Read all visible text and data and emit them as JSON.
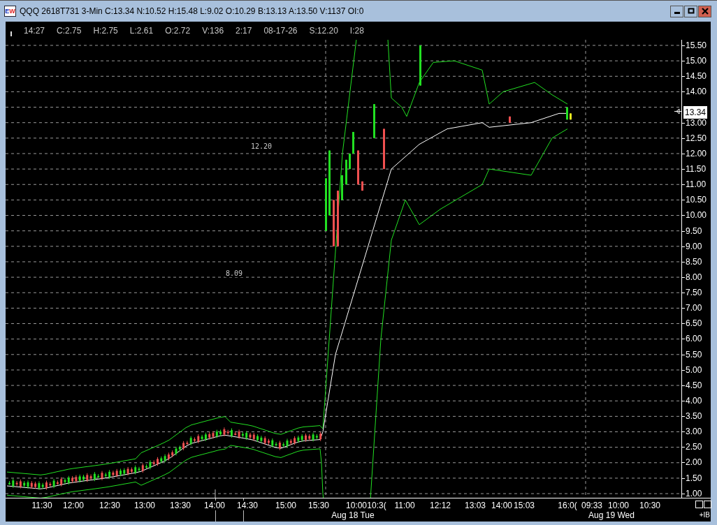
{
  "window": {
    "logo_letters": [
      "E",
      "W"
    ],
    "title": "QQQ 2618T731 3-Min C:13.34 N:10.52 H:15.48 L:9.02 O:10.29 B:13.13 A:13.50 V:1137 OI:0"
  },
  "info_bar": [
    "14:27",
    "C:2.75",
    "H:2.75",
    "L:2.61",
    "O:2.72",
    "V:136",
    "2:17",
    "08-17-26",
    "S:12.20",
    "I:28"
  ],
  "chart": {
    "labels": [
      "12.20",
      "8.09"
    ],
    "current_price": "13.34"
  },
  "price_axis": [
    "15.50",
    "15.00",
    "14.50",
    "14.00",
    "13.00",
    "12.50",
    "12.00",
    "11.50",
    "11.00",
    "10.50",
    "10.00",
    "9.50",
    "9.00",
    "8.50",
    "8.00",
    "7.50",
    "7.00",
    "6.50",
    "6.00",
    "5.50",
    "5.00",
    "4.50",
    "4.00",
    "3.50",
    "3.00",
    "2.50",
    "2.00",
    "1.50",
    "1.00"
  ],
  "time_axis": {
    "times": [
      "11:30",
      "12:00",
      "12:30",
      "13:00",
      "13:30",
      "14:00",
      "14:30",
      "15:00",
      "15:30",
      "10:00",
      "10:3(",
      "11:00",
      "12:12",
      "13:03",
      "14:00",
      "15:03",
      "16:0(",
      "09:33",
      "10:00",
      "10:30"
    ],
    "dates": [
      "Aug 18 Tue",
      "Aug 19 Wed"
    ],
    "corner": "+IB"
  }
}
